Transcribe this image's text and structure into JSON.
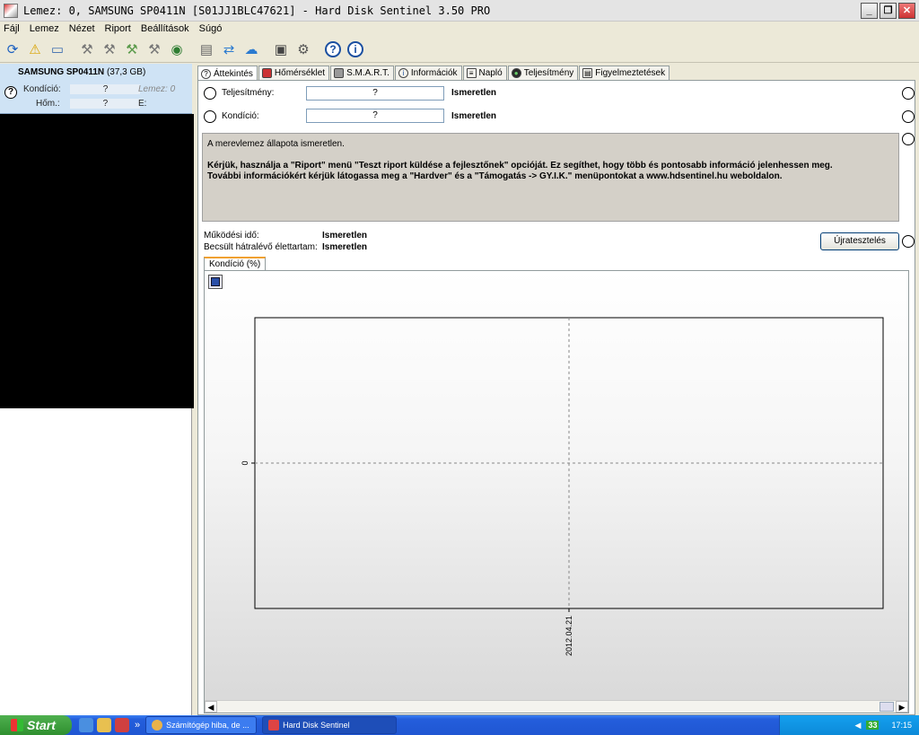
{
  "window": {
    "title": "Lemez: 0, SAMSUNG SP0411N [S01JJ1BLC47621]  -  Hard Disk Sentinel 3.50 PRO",
    "minimize": "_",
    "restore": "❐",
    "close": "✕"
  },
  "menu": [
    "Fájl",
    "Lemez",
    "Nézet",
    "Riport",
    "Beállítások",
    "Súgó"
  ],
  "toolbar": {
    "icons": [
      "refresh-icon",
      "alert-icon",
      "disk-icon",
      "tool-icon",
      "tool-icon",
      "tool-icon",
      "tool-icon",
      "globe-icon",
      "report-icon",
      "sync-icon",
      "network-icon",
      "chart-icon",
      "settings-icon",
      "help-icon",
      "info-icon"
    ]
  },
  "left": {
    "disk_name": "SAMSUNG SP0411N",
    "disk_size": "(37,3 GB)",
    "condition_label": "Kondíció:",
    "condition_value": "?",
    "extra_label": "Lemez: 0",
    "temp_label": "Hőm.:",
    "temp_value": "?",
    "drive_label": "E:"
  },
  "tabs": [
    {
      "label": "Áttekintés",
      "icon": "help-icon"
    },
    {
      "label": "Hőmérséklet",
      "icon": "thermometer-icon"
    },
    {
      "label": "S.M.A.R.T.",
      "icon": "disk-icon"
    },
    {
      "label": "Információk",
      "icon": "info-icon"
    },
    {
      "label": "Napló",
      "icon": "log-icon"
    },
    {
      "label": "Teljesítmény",
      "icon": "performance-icon"
    },
    {
      "label": "Figyelmeztetések",
      "icon": "warning-icon"
    }
  ],
  "overview": {
    "performance_label": "Teljesítmény:",
    "performance_value": "?",
    "performance_status": "Ismeretlen",
    "condition_label": "Kondíció:",
    "condition_value": "?",
    "condition_status": "Ismeretlen",
    "info_line1": "A merevlemez állapota ismeretlen.",
    "info_line2": "Kérjük, használja a \"Riport\" menü \"Teszt riport küldése a fejlesztőnek\" opcióját. Ez segíthet, hogy több és pontosabb információ jelenhessen meg.",
    "info_line3": "További információkért kérjük látogassa meg a \"Hardver\" és a \"Támogatás -> GY.I.K.\" menüpontokat a www.hdsentinel.hu weboldalon.",
    "uptime_label": "Működési idő:",
    "uptime_value": "Ismeretlen",
    "remaining_label": "Becsült hátralévő élettartam:",
    "remaining_value": "Ismeretlen",
    "retest_button": "Újratesztelés",
    "chart_tab": "Kondíció  (%)"
  },
  "chart_data": {
    "type": "line",
    "x": [
      "2012.04.21"
    ],
    "y_ticks": [
      "0"
    ],
    "series": []
  },
  "taskbar": {
    "start": "Start",
    "more": "»",
    "task1": "Számítógép hiba, de ...",
    "task2": "Hard Disk Sentinel",
    "tray_count": "33",
    "clock": "17:15"
  }
}
